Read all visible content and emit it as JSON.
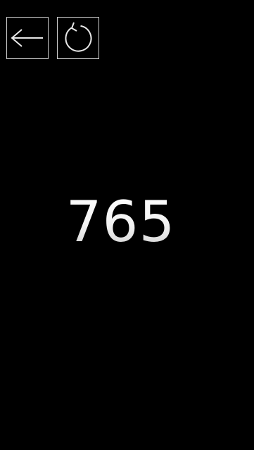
{
  "toolbar": {
    "back_icon": "arrow-left-icon",
    "refresh_icon": "refresh-icon"
  },
  "main": {
    "value": "765"
  },
  "colors": {
    "background": "#000000",
    "foreground": "#eeeeee",
    "button_border": "#cfcfcf"
  }
}
